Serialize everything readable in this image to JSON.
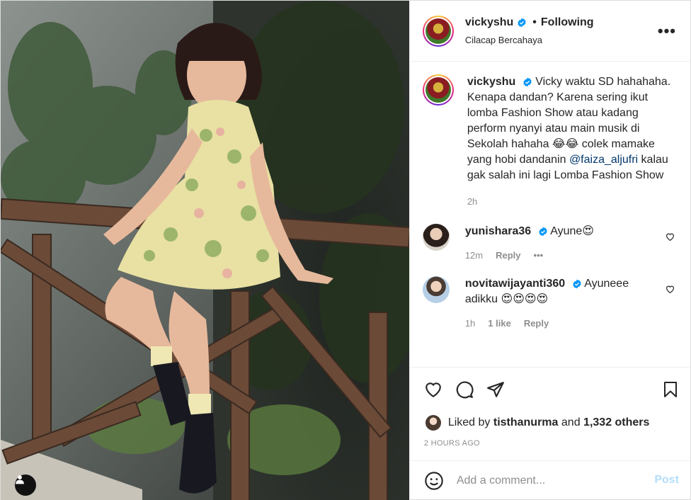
{
  "post": {
    "username": "vickyshu",
    "follow_status": "Following",
    "location": "Cilacap Bercahaya",
    "more_label": "•••"
  },
  "caption": {
    "username": "vickyshu",
    "text_part1": "Vicky waktu SD hahahaha. Kenapa dandan? Karena sering ikut lomba Fashion Show atau kadang perform nyanyi atau main musik di Sekolah hahaha 😂😂 colek mamake yang hobi dandanin ",
    "mention": "@faiza_aljufri",
    "text_part2": " kalau gak salah ini lagi Lomba Fashion Show",
    "time": "2h"
  },
  "comments": [
    {
      "username": "yunishara36",
      "text": "Ayune😍",
      "time": "12m",
      "reply_label": "Reply",
      "more_label": "•••"
    },
    {
      "username": "novitawijayanti360",
      "text": "Ayuneee adikku 😍😍😍😍",
      "time": "1h",
      "likes": "1 like",
      "reply_label": "Reply"
    }
  ],
  "likes": {
    "prefix": "Liked by",
    "user": "tisthanurma",
    "middle": "and",
    "others": "1,332 others"
  },
  "timestamp": "2 HOURS AGO",
  "add_comment": {
    "placeholder": "Add a comment...",
    "post_label": "Post"
  },
  "colors": {
    "link": "#00376b",
    "post_button": "#b2dffc",
    "verified": "#0095f6",
    "muted": "#8e8e8e"
  }
}
